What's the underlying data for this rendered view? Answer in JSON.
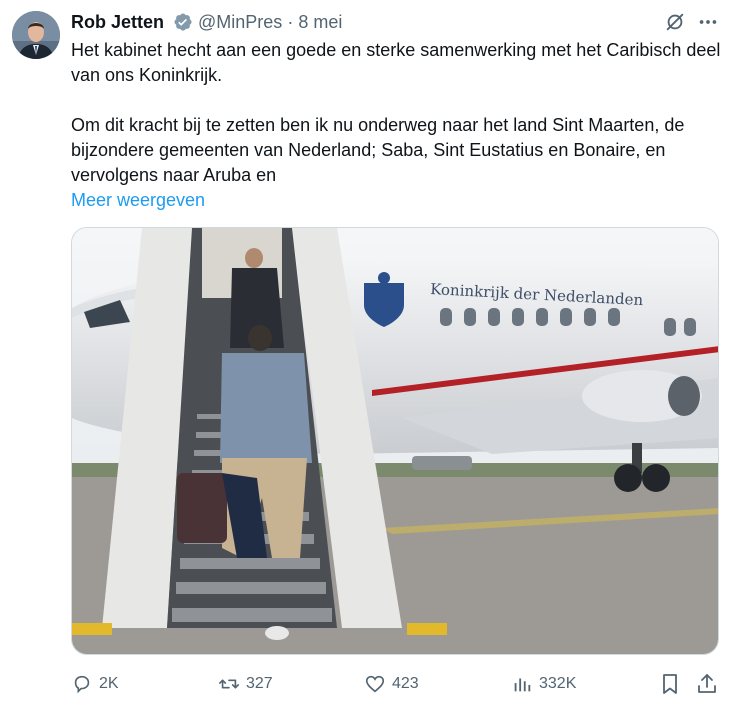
{
  "author": {
    "name": "Rob Jetten",
    "handle": "@MinPres",
    "separator": "·",
    "date": "8 mei",
    "avatar_icon": "profile-photo"
  },
  "tweet": {
    "text": "Het kabinet hecht aan een goede en sterke samenwerking met het Caribisch deel van ons Koninkrijk.\n\nOm dit kracht bij te zetten ben ik nu onderweg naar het land Sint Maarten, de bijzondere gemeenten van Nederland; Saba, Sint Eustatius en Bonaire, en vervolgens naar Aruba en",
    "show_more": "Meer weergeven",
    "image_text": "Koninkrijk der Nederlanden"
  },
  "actions": {
    "replies": "2K",
    "reposts": "327",
    "likes": "423",
    "views": "332K"
  },
  "colors": {
    "link": "#1d9bf0",
    "muted": "#536471",
    "verified": "#829aab"
  }
}
